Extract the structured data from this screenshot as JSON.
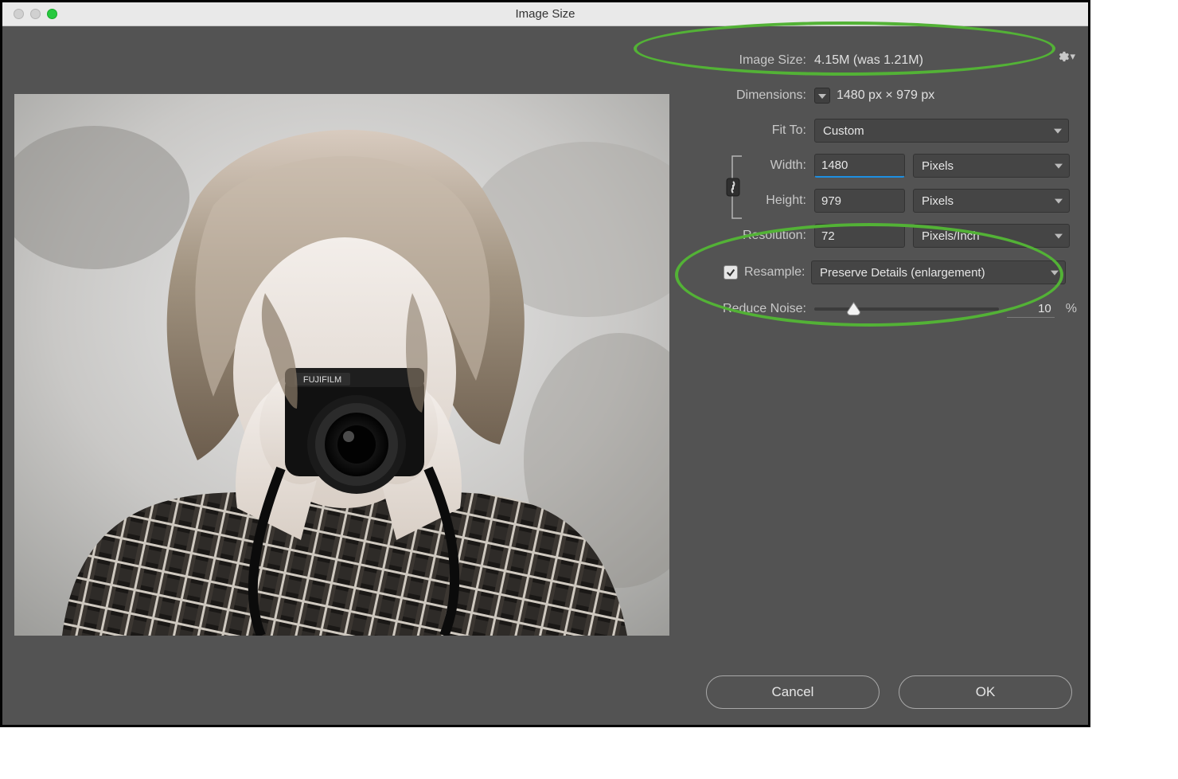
{
  "window": {
    "title": "Image Size"
  },
  "info": {
    "image_size_label": "Image Size:",
    "image_size_value": "4.15M (was 1.21M)",
    "dimensions_label": "Dimensions:",
    "dimensions_value": "1480 px  ×  979 px"
  },
  "fit_to_label": "Fit To:",
  "fit_to_value": "Custom",
  "width_label": "Width:",
  "width_value": "1480",
  "width_unit": "Pixels",
  "height_label": "Height:",
  "height_value": "979",
  "height_unit": "Pixels",
  "resolution_label": "Resolution:",
  "resolution_value": "72",
  "resolution_unit": "Pixels/Inch",
  "resample_label": "Resample:",
  "resample_checked": true,
  "resample_value": "Preserve Details (enlargement)",
  "noise_label": "Reduce Noise:",
  "noise_value": "10",
  "noise_percent": "%",
  "buttons": {
    "cancel": "Cancel",
    "ok": "OK"
  },
  "colors": {
    "highlight": "#53b236"
  }
}
